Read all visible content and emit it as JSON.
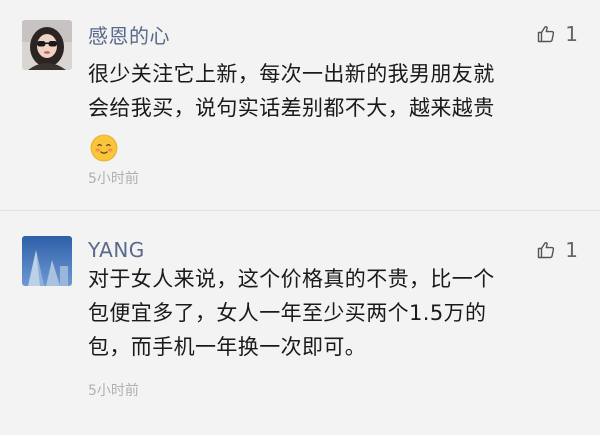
{
  "comments": [
    {
      "username": "感恩的心",
      "likes": "1",
      "lines": [
        "很少关注它上新，每次一出新的我男朋友就",
        "会给我买，说句实话差别都不大，越来越贵"
      ],
      "emoji": "smiling-face",
      "time": "5小时前"
    },
    {
      "username": "YANG",
      "likes": "1",
      "lines": [
        "对于女人来说，这个价格真的不贵，比一个",
        "包便宜多了，女人一年至少买两个1.5万的",
        "包，而手机一年换一次即可。"
      ],
      "time": "5小时前"
    }
  ],
  "colors": {
    "background": "#f3f3f3",
    "username": "#5a6a8a",
    "timestamp": "#b0b0b0",
    "emoji_face": "#f9c53a",
    "emoji_cheek": "#f27a5a"
  }
}
